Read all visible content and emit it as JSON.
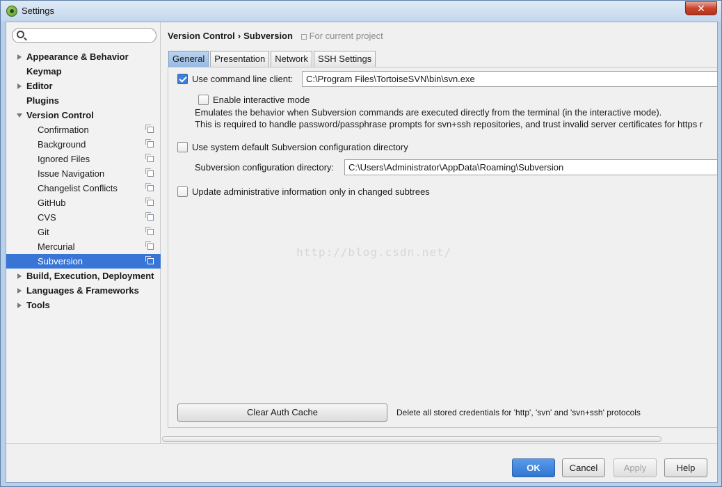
{
  "window": {
    "title": "Settings",
    "close_label": "✕"
  },
  "search": {
    "placeholder": ""
  },
  "sidebar": {
    "items": [
      {
        "label": "Appearance & Behavior",
        "level": 0,
        "expandable": true,
        "expanded": false
      },
      {
        "label": "Keymap",
        "level": 0,
        "expandable": false
      },
      {
        "label": "Editor",
        "level": 0,
        "expandable": true,
        "expanded": false
      },
      {
        "label": "Plugins",
        "level": 0,
        "expandable": false
      },
      {
        "label": "Version Control",
        "level": 0,
        "expandable": true,
        "expanded": true
      },
      {
        "label": "Confirmation",
        "level": 1,
        "project_icon": true
      },
      {
        "label": "Background",
        "level": 1,
        "project_icon": true
      },
      {
        "label": "Ignored Files",
        "level": 1,
        "project_icon": true
      },
      {
        "label": "Issue Navigation",
        "level": 1,
        "project_icon": true
      },
      {
        "label": "Changelist Conflicts",
        "level": 1,
        "project_icon": true
      },
      {
        "label": "GitHub",
        "level": 1,
        "project_icon": true
      },
      {
        "label": "CVS",
        "level": 1,
        "project_icon": true
      },
      {
        "label": "Git",
        "level": 1,
        "project_icon": true
      },
      {
        "label": "Mercurial",
        "level": 1,
        "project_icon": true
      },
      {
        "label": "Subversion",
        "level": 1,
        "project_icon": true,
        "selected": true
      },
      {
        "label": "Build, Execution, Deployment",
        "level": 0,
        "expandable": true,
        "expanded": false
      },
      {
        "label": "Languages & Frameworks",
        "level": 0,
        "expandable": true,
        "expanded": false
      },
      {
        "label": "Tools",
        "level": 0,
        "expandable": true,
        "expanded": false
      }
    ]
  },
  "breadcrumb": {
    "parent": "Version Control",
    "separator": "›",
    "current": "Subversion",
    "scope": "For current project"
  },
  "tabs": [
    {
      "label": "General",
      "active": true
    },
    {
      "label": "Presentation",
      "active": false
    },
    {
      "label": "Network",
      "active": false
    },
    {
      "label": "SSH Settings",
      "active": false
    }
  ],
  "general": {
    "use_cmd_client": {
      "label": "Use command line client:",
      "checked": true,
      "value": "C:\\Program Files\\TortoiseSVN\\bin\\svn.exe"
    },
    "interactive_mode": {
      "label": "Enable interactive mode",
      "checked": false
    },
    "description_line1": "Emulates the behavior when Subversion commands are executed directly from the terminal (in the interactive mode).",
    "description_line2": "This is required to handle password/passphrase prompts for svn+ssh repositories, and trust invalid server certificates for https r",
    "use_system_default": {
      "label": "Use system default Subversion configuration directory",
      "checked": false
    },
    "config_dir": {
      "label": "Subversion configuration directory:",
      "value": "C:\\Users\\Administrator\\AppData\\Roaming\\Subversion"
    },
    "update_admin_info": {
      "label": "Update administrative information only in changed subtrees",
      "checked": false
    },
    "watermark": "http://blog.csdn.net/",
    "clear_auth_cache": "Clear Auth Cache",
    "clear_auth_desc": "Delete all stored credentials for 'http', 'svn' and 'svn+ssh' protocols"
  },
  "footer": {
    "ok": "OK",
    "cancel": "Cancel",
    "apply": "Apply",
    "help": "Help"
  },
  "colors": {
    "selection": "#3875d7",
    "primary_button": "#3b7fd9",
    "active_tab": "#a9c7ea"
  }
}
